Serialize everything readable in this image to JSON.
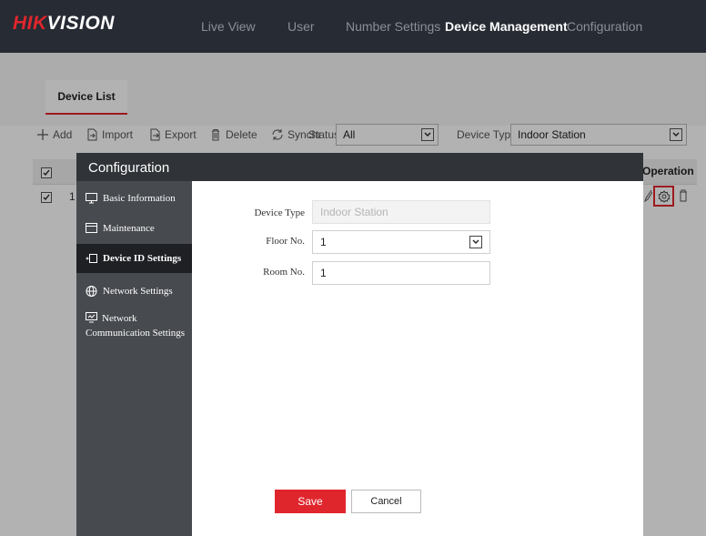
{
  "brand": {
    "logo_red": "HIK",
    "logo_white": "VISION"
  },
  "nav": [
    {
      "label": "Live View",
      "active": false
    },
    {
      "label": "User",
      "active": false
    },
    {
      "label": "Number Settings",
      "active": false
    },
    {
      "label": "Device Management",
      "active": true
    },
    {
      "label": "Configuration",
      "active": false
    }
  ],
  "tabs": {
    "device_list": "Device List"
  },
  "toolbar": {
    "add": "Add",
    "import": "Import",
    "export": "Export",
    "delete": "Delete",
    "sync": "Synchronize",
    "status_label": "Status",
    "status_value": "All",
    "device_type_label": "Device Type",
    "device_type_value": "Indoor Station"
  },
  "table": {
    "last_col_header": "Operation",
    "row_index": "1"
  },
  "modal": {
    "title": "Configuration",
    "sidebar": [
      {
        "label": "Basic Information",
        "icon": "monitor-icon",
        "active": false
      },
      {
        "label": "Maintenance",
        "icon": "window-icon",
        "active": false
      },
      {
        "label": "Device ID Settings",
        "icon": "device-id-icon",
        "active": true
      },
      {
        "label": "Network Settings",
        "icon": "globe-icon",
        "active": false
      },
      {
        "label": "Network Communication Settings",
        "icon": "network-monitor-icon",
        "active": false
      }
    ],
    "form": {
      "device_type_label": "Device Type",
      "device_type_value": "Indoor Station",
      "floor_label": "Floor No.",
      "floor_value": "1",
      "room_label": "Room No.",
      "room_value": "1"
    },
    "save": "Save",
    "cancel": "Cancel"
  },
  "colors": {
    "brand_red": "#e0262d",
    "nav_bg": "#272b33",
    "sidebar_bg": "#474a4f",
    "sidebar_active": "#1e2024"
  }
}
